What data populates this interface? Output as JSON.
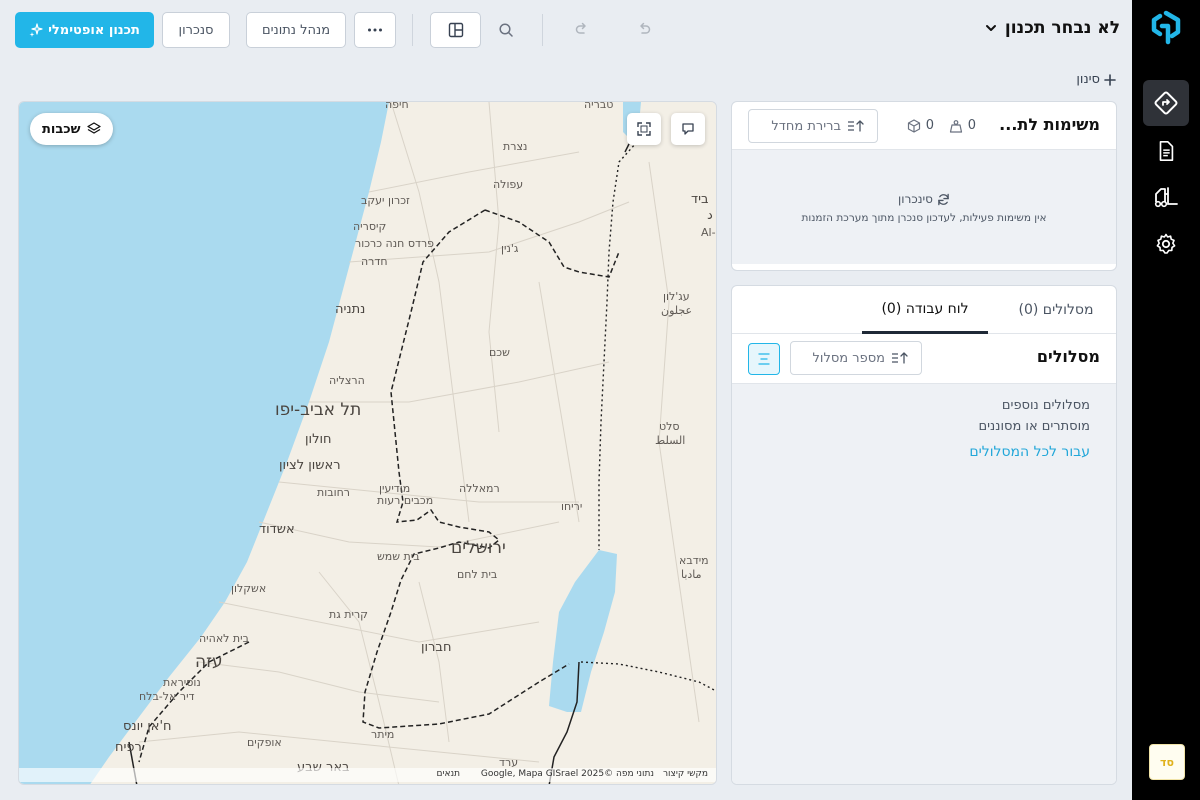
{
  "header": {
    "plan_title": "לא נבחר תכנון",
    "optimal_planning": "תכנון אופטימלי",
    "sync": "סנכרון",
    "data_manager": "מנהל נתונים",
    "filter": "סינון"
  },
  "rail": {
    "avatar": "סד"
  },
  "tasks": {
    "title": "משימות לת...",
    "weight_count": "0",
    "package_count": "0",
    "sort_label": "ברירת מחדל",
    "sync_link": "סינכרון",
    "empty_message": "אין משימות פעילות, לעדכון סנכרן מתוך מערכת הזמנות"
  },
  "routes": {
    "tab_routes": "מסלולים (0)",
    "tab_workboard": "לוח עבודה (0)",
    "title": "מסלולים",
    "sort_label": "מספר מסלול",
    "note_line1": "מסלולים נוספים",
    "note_line2": "מוסתרים או מסוננים",
    "all_routes_link": "עבור לכל המסלולים"
  },
  "map": {
    "layers_label": "שכבות",
    "attribution_shortcuts": "מקשי קיצור",
    "attribution_data": "נתוני מפה ©2025 Google, Mapa GISrael",
    "attribution_terms": "תנאים",
    "labels": {
      "tiberias": "טבריה",
      "haifa": "חיפה",
      "nazareth": "נצרת",
      "afula": "עפולה",
      "zikhron": "זכרון יעקב",
      "caesarea": "קיסריה",
      "pardes_hanna": "פרדס חנה כרכור",
      "hadera": "חדרה",
      "jenin": "ג'נין",
      "netanya": "נתניה",
      "shechem": "שכם",
      "herzliya": "הרצליה",
      "tel_aviv": "תל אביב-יפו",
      "holon": "חולון",
      "rishon": "ראשון לציון",
      "rehovot": "רחובות",
      "modiin": "מודיעין",
      "modiin2": "מכבים רעות",
      "ramallah": "רמאללה",
      "jericho": "יריחו",
      "jerusalem": "ירושלים",
      "ashdod": "אשדוד",
      "beit_shemesh": "בית שמש",
      "beit_lehem": "בית לחם",
      "ashkelon": "אשקלון",
      "kiryat_gat": "קרית גת",
      "beit_lahia": "בית לאהיה",
      "gaza": "עזה",
      "nuseirat": "נוסיראת",
      "deir_al_balah": "דיר אל-בלח",
      "khan_yunis": "ח'אן יונס",
      "rafah": "רפיח",
      "hebron": "חברון",
      "ofakim": "אופקים",
      "meitar": "מיתר",
      "beer_sheva": "באר שבע",
      "arad": "ערד",
      "ajloun": "עג'לון",
      "ajloun_ar": "عجلون",
      "salt": "סלט",
      "salt_ar": "السلط",
      "madaba": "מידבא",
      "madaba_ar": "مادبا",
      "irbid_frag": "ביד",
      "irbid_ar": "د",
      "al_frag": "Al-I"
    }
  }
}
